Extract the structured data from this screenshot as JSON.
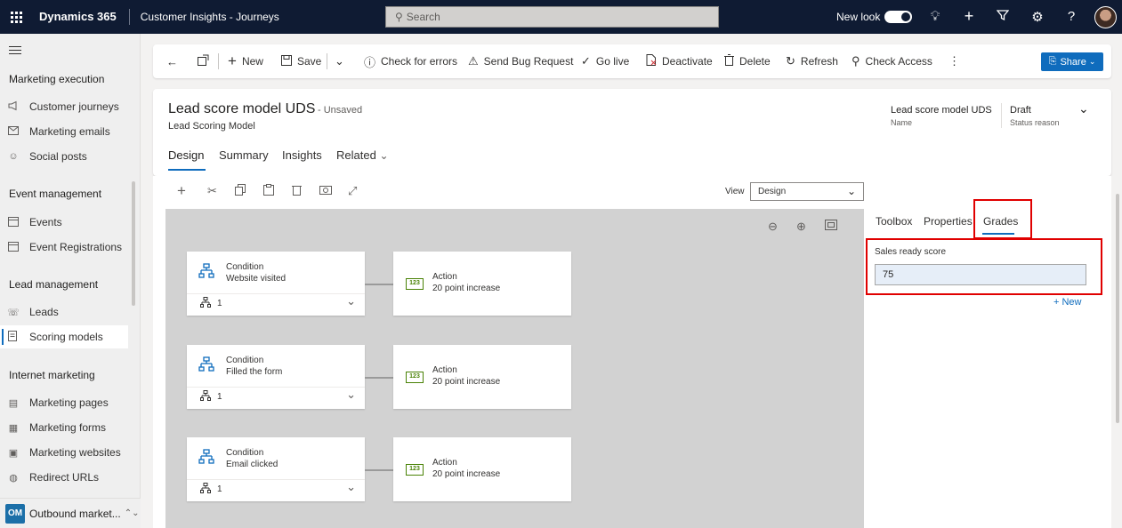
{
  "topbar": {
    "brand": "Dynamics 365",
    "app_name": "Customer Insights - Journeys",
    "search_placeholder": "Search",
    "new_look_label": "New look"
  },
  "sidebar": {
    "groups": [
      {
        "label": "Marketing execution",
        "items": [
          {
            "label": "Customer journeys",
            "icon": "megaphone-icon"
          },
          {
            "label": "Marketing emails",
            "icon": "mail-icon"
          },
          {
            "label": "Social posts",
            "icon": "social-icon"
          }
        ]
      },
      {
        "label": "Event management",
        "items": [
          {
            "label": "Events",
            "icon": "calendar-icon"
          },
          {
            "label": "Event Registrations",
            "icon": "calendar-icon"
          }
        ]
      },
      {
        "label": "Lead management",
        "items": [
          {
            "label": "Leads",
            "icon": "phone-person-icon"
          },
          {
            "label": "Scoring models",
            "icon": "scoring-icon",
            "active": true
          }
        ]
      },
      {
        "label": "Internet marketing",
        "items": [
          {
            "label": "Marketing pages",
            "icon": "page-icon"
          },
          {
            "label": "Marketing forms",
            "icon": "form-icon"
          },
          {
            "label": "Marketing websites",
            "icon": "website-icon"
          },
          {
            "label": "Redirect URLs",
            "icon": "globe-icon"
          }
        ]
      }
    ],
    "area_badge": "OM",
    "area_label": "Outbound market..."
  },
  "commandbar": {
    "new": "New",
    "save": "Save",
    "check_errors": "Check for errors",
    "send_bug": "Send Bug Request",
    "go_live": "Go live",
    "deactivate": "Deactivate",
    "delete": "Delete",
    "refresh": "Refresh",
    "check_access": "Check Access",
    "share": "Share"
  },
  "record": {
    "title": "Lead score model UDS",
    "unsaved": "- Unsaved",
    "entity": "Lead Scoring Model",
    "name_value": "Lead score model UDS",
    "name_label": "Name",
    "status_value": "Draft",
    "status_label": "Status reason"
  },
  "tabs": {
    "design": "Design",
    "summary": "Summary",
    "insights": "Insights",
    "related": "Related"
  },
  "designer": {
    "view_label": "View",
    "view_value": "Design",
    "rows": [
      {
        "condition_type": "Condition",
        "condition_name": "Website visited",
        "branch_count": "1",
        "action_type": "Action",
        "action_name": "20 point increase",
        "action_badge": "123"
      },
      {
        "condition_type": "Condition",
        "condition_name": "Filled the form",
        "branch_count": "1",
        "action_type": "Action",
        "action_name": "20 point increase",
        "action_badge": "123"
      },
      {
        "condition_type": "Condition",
        "condition_name": "Email clicked",
        "branch_count": "1",
        "action_type": "Action",
        "action_name": "20 point increase",
        "action_badge": "123"
      }
    ]
  },
  "panel": {
    "tabs": {
      "toolbox": "Toolbox",
      "properties": "Properties",
      "grades": "Grades"
    },
    "field_label": "Sales ready score",
    "field_value": "75",
    "add_new": "+ New"
  }
}
